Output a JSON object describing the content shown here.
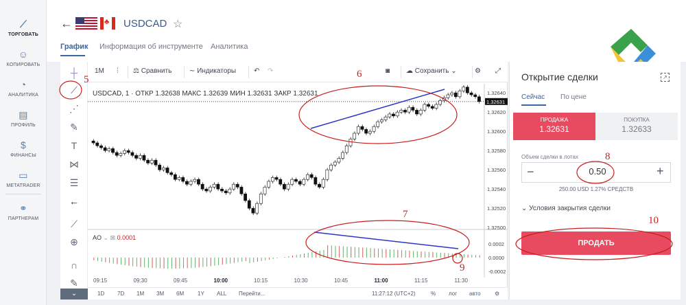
{
  "leftnav": {
    "items": [
      {
        "label": "ТОРГОВАТЬ",
        "icon": "chart-icon"
      },
      {
        "label": "КОПИРОВАТЬ",
        "icon": "user-copy-icon"
      },
      {
        "label": "АНАЛИТИКА",
        "icon": "analytics-icon"
      },
      {
        "label": "ПРОФИЛЬ",
        "icon": "profile-icon"
      },
      {
        "label": "ФИНАНСЫ",
        "icon": "dollar-icon"
      },
      {
        "label": "METATRADER",
        "icon": "window-icon"
      },
      {
        "label": "ПАРТНЕРАМ",
        "icon": "handshake-icon"
      }
    ]
  },
  "header": {
    "symbol": "USDCAD",
    "tabs": [
      "График",
      "Информация об инструменте",
      "Аналитика"
    ]
  },
  "toolbar": {
    "interval": "1M",
    "compare": "Сравнить",
    "indicators": "Индикаторы",
    "save": "Сохранить"
  },
  "legend": {
    "text": "USDCAD, 1 ·  ОТКР 1.32638  МАКС 1.32639  МИН 1.32631  ЗАКР 1.32631"
  },
  "ao": {
    "name": "AO",
    "value": "0.0001"
  },
  "price_axis": {
    "labels": [
      "1.32640",
      "1.32620",
      "1.32600",
      "1.32580",
      "1.32560",
      "1.32540",
      "1.32520",
      "1.32500"
    ],
    "current": "1.32631"
  },
  "ao_axis": {
    "labels": [
      "0.0002",
      "0.0000",
      "-0.0002"
    ]
  },
  "time_axis": {
    "labels": [
      "09:15",
      "09:30",
      "09:45",
      "10:00",
      "10:15",
      "10:30",
      "10:45",
      "11:00",
      "11:15",
      "11:30"
    ],
    "bold": [
      "10:00",
      "11:00"
    ]
  },
  "bottom_bar": {
    "ranges": [
      "1D",
      "7D",
      "1M",
      "3M",
      "6M",
      "1Y",
      "ALL"
    ],
    "goto": "Перейти...",
    "clock": "11:27:12 (UTC+2)",
    "percent": "%",
    "log": "лог",
    "auto": "авто"
  },
  "order": {
    "title": "Открытие сделки",
    "tabs": [
      "Сейчас",
      "По цене"
    ],
    "sell_label": "ПРОДАЖА",
    "sell_price": "1.32631",
    "buy_label": "ПОКУПКА",
    "buy_price": "1.32633",
    "volume_label": "Объем сделки в лотах",
    "volume": "0.50",
    "volume_info": "250.00 USD   1.27% СРЕДСТВ",
    "conditions": "Условия закрытия сделки",
    "submit": "ПРОДАТЬ"
  },
  "annotations": [
    "5",
    "6",
    "7",
    "8",
    "9",
    "10"
  ],
  "colors": {
    "accent": "#3a66a5",
    "sell": "#e84a5f",
    "annotation": "#c81e1e",
    "trendline": "#2b35c8"
  }
}
